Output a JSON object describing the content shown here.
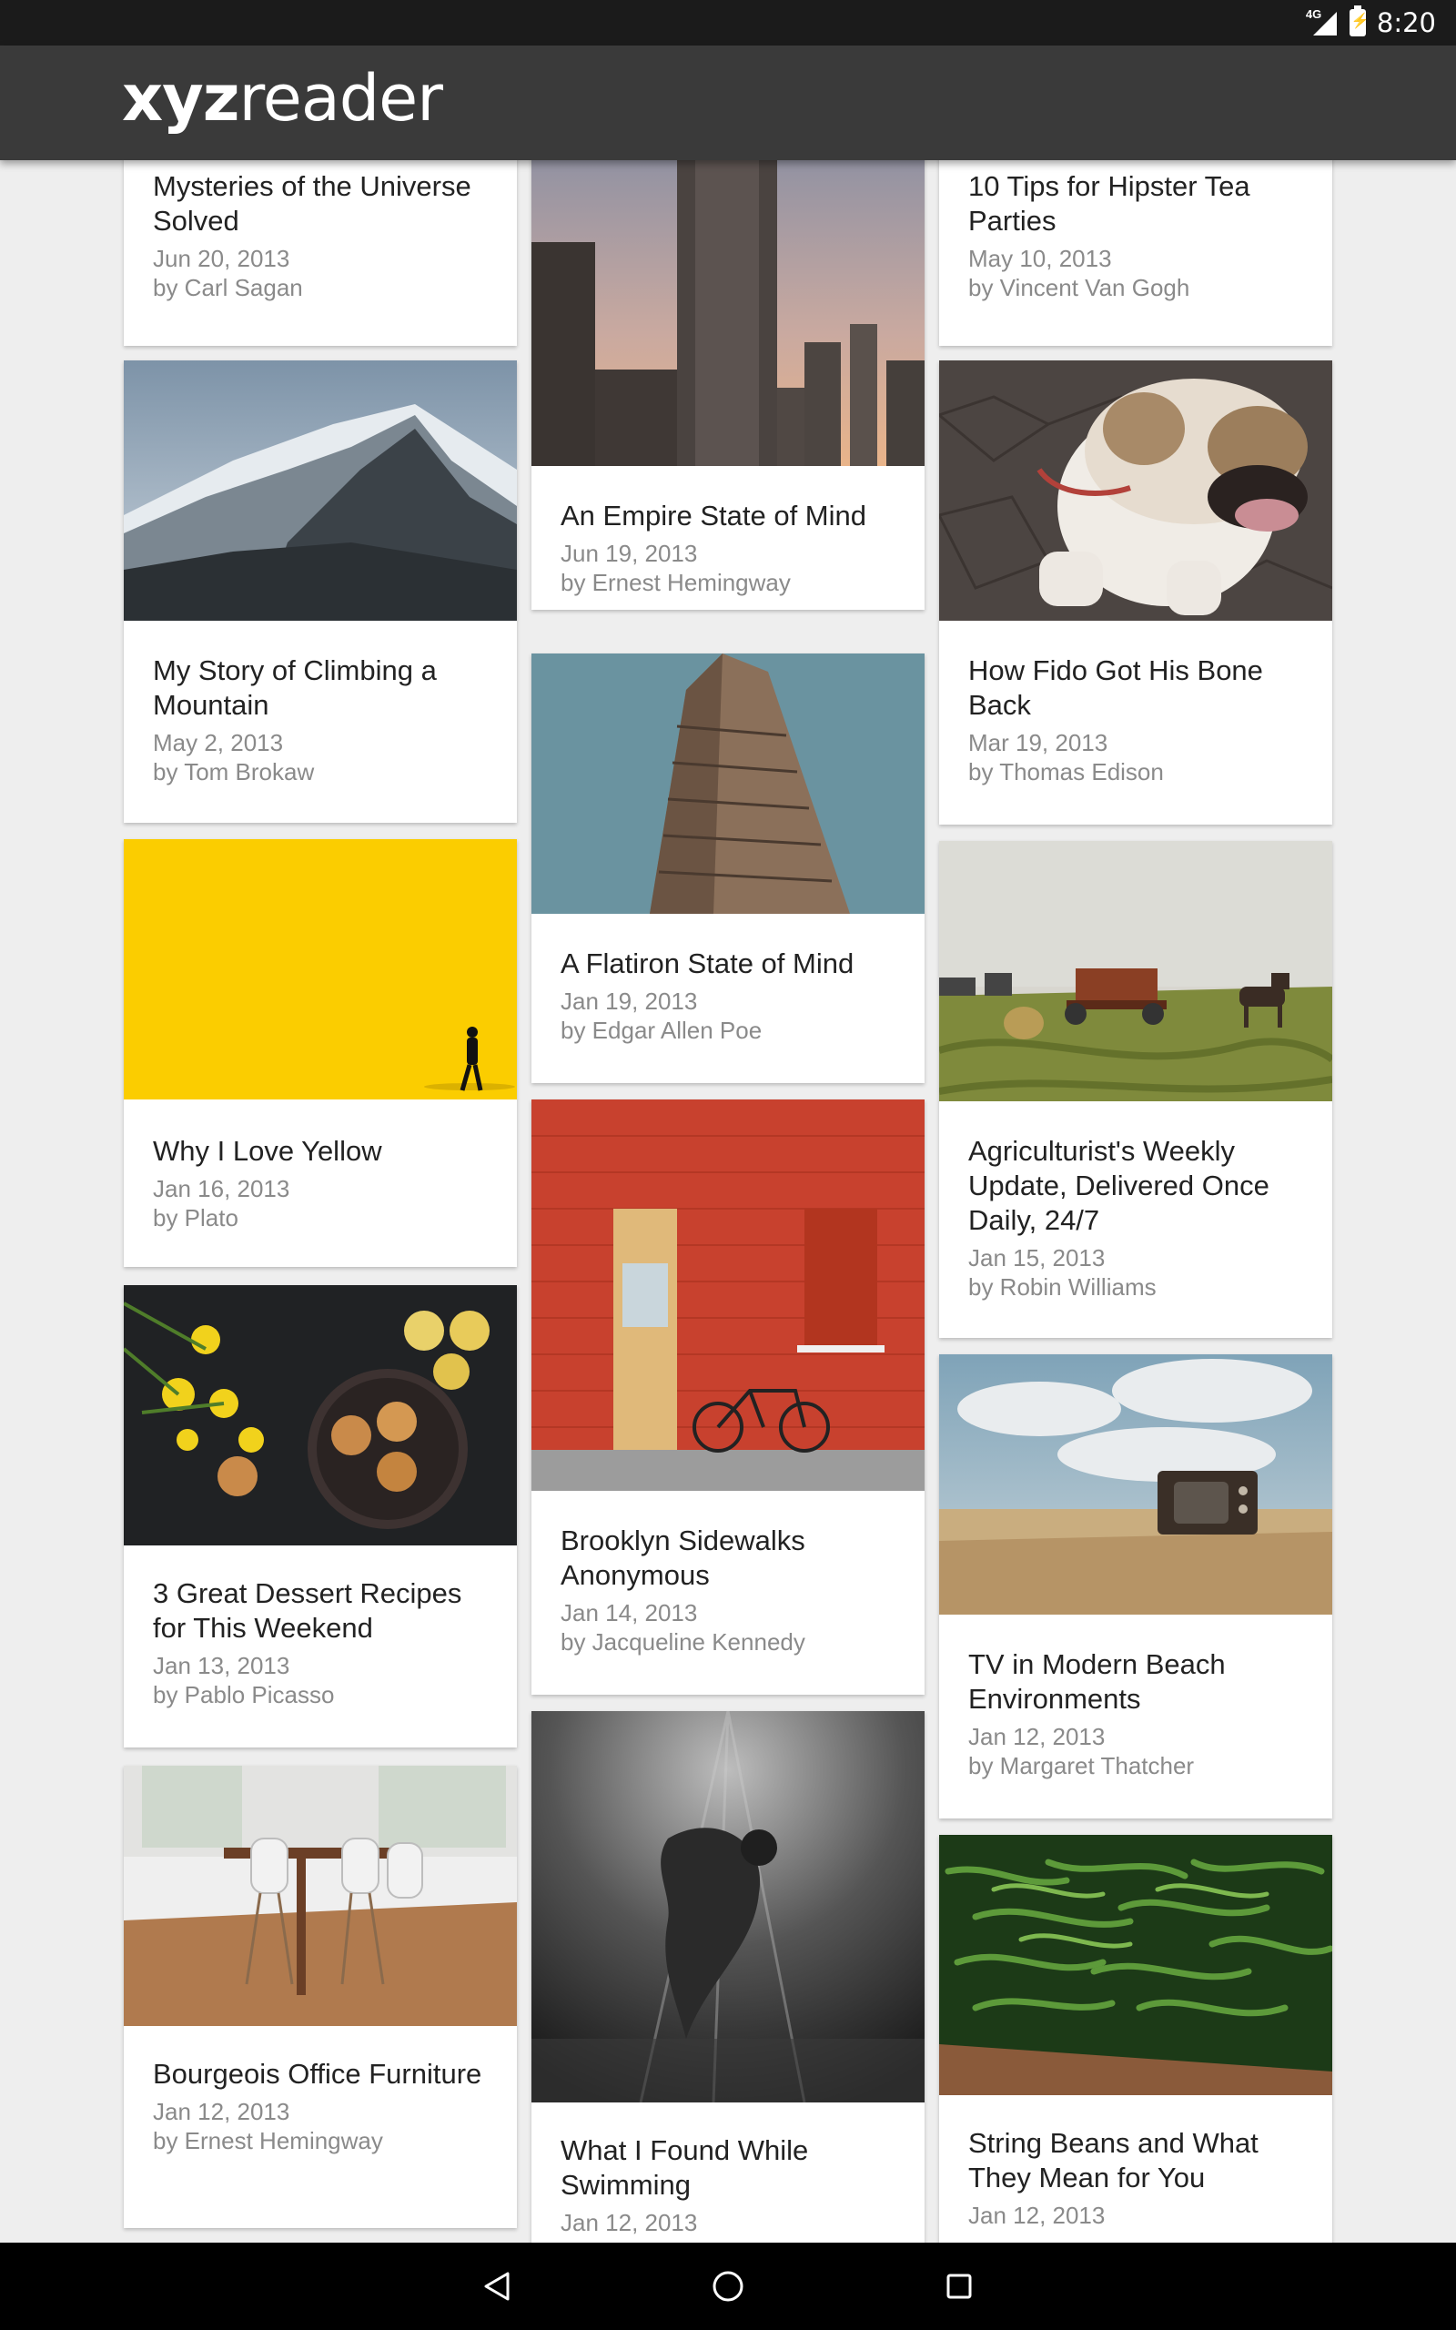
{
  "status_bar": {
    "network": "4G",
    "time": "8:20"
  },
  "app_bar": {
    "logo_bold": "xyz",
    "logo_light": "reader"
  },
  "articles": [
    {
      "title": "Mysteries of the Universe Solved",
      "date": "Jun 20, 2013",
      "author": "by Carl Sagan"
    },
    {
      "title": "An Empire State of Mind",
      "date": "Jun 19, 2013",
      "author": "by Ernest Hemingway",
      "image": "empire-state-building-photo"
    },
    {
      "title": "10 Tips for Hipster Tea Parties",
      "date": "May 10, 2013",
      "author": "by Vincent Van Gogh"
    },
    {
      "title": "My Story of Climbing a Mountain",
      "date": "May 2, 2013",
      "author": "by Tom Brokaw",
      "image": "snowy-mountain-photo"
    },
    {
      "title": "How Fido Got His Bone Back",
      "date": "Mar 19, 2013",
      "author": "by Thomas Edison",
      "image": "bulldog-photo"
    },
    {
      "title": "A Flatiron State of Mind",
      "date": "Jan 19, 2013",
      "author": "by Edgar Allen Poe",
      "image": "flatiron-building-photo"
    },
    {
      "title": "Why I Love Yellow",
      "date": "Jan 16, 2013",
      "author": "by Plato",
      "image": "yellow-wall-photo"
    },
    {
      "title": "Agriculturist's Weekly Update, Delivered Once Daily, 24/7",
      "date": "Jan 15, 2013",
      "author": "by Robin Williams",
      "image": "farm-field-photo"
    },
    {
      "title": "Brooklyn Sidewalks Anonymous",
      "date": "Jan 14, 2013",
      "author": "by Jacqueline Kennedy",
      "image": "red-brick-wall-bicycle-photo"
    },
    {
      "title": "3 Great Dessert Recipes for This Weekend",
      "date": "Jan 13, 2013",
      "author": "by Pablo Picasso",
      "image": "cookies-and-flowers-photo"
    },
    {
      "title": "TV in Modern Beach Environments",
      "date": "Jan 12, 2013",
      "author": "by Margaret Thatcher",
      "image": "tv-on-beach-photo"
    },
    {
      "title": "Bourgeois Office Furniture",
      "date": "Jan 12, 2013",
      "author": "by Ernest Hemingway",
      "image": "dining-table-photo"
    },
    {
      "title": "What I Found While Swimming",
      "date": "Jan 12, 2013",
      "author": "",
      "image": "underwater-swimmer-photo"
    },
    {
      "title": "String Beans and What They Mean for You",
      "date": "Jan 12, 2013",
      "author": "",
      "image": "green-beans-photo"
    }
  ],
  "nav_bar": {
    "back_icon": "back-triangle-icon",
    "home_icon": "home-circle-icon",
    "recents_icon": "recents-square-icon"
  }
}
